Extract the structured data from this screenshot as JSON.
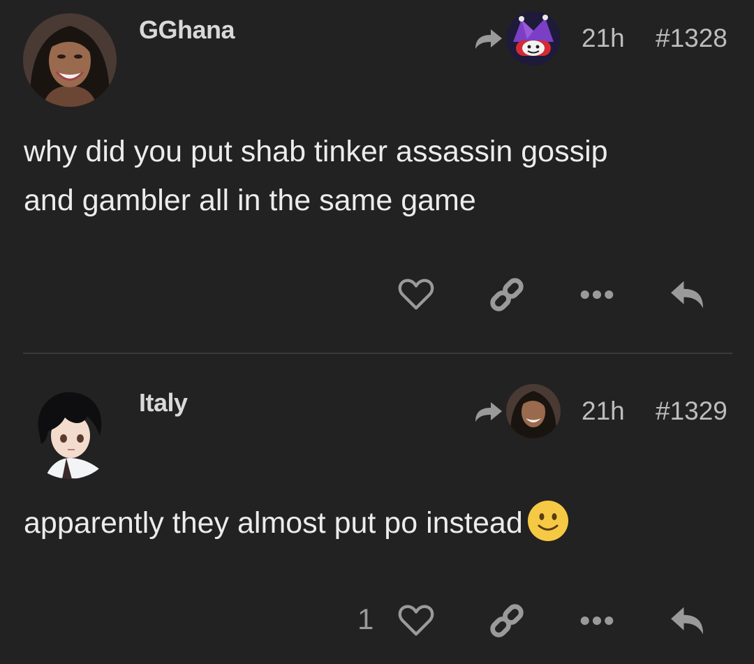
{
  "posts": [
    {
      "username": "GGhana",
      "time": "21h",
      "post_number": "#1328",
      "body_lines": [
        "why did you put shab tinker assassin gossip",
        "and gambler all in the same game"
      ],
      "like_count": "",
      "reply_to_avatar": "jester-avatar"
    },
    {
      "username": "Italy",
      "time": "21h",
      "post_number": "#1329",
      "body_lines": [
        "apparently they almost put po instead"
      ],
      "like_count": "1",
      "reply_to_avatar": "gghana-avatar",
      "emoji": "slightly-smiling-face"
    }
  ],
  "icons": {
    "like": "heart-icon",
    "link": "link-icon",
    "more": "more-dots-icon",
    "reply": "reply-icon",
    "reply_to": "reply-to-arrow-icon"
  },
  "colors": {
    "background": "#222222",
    "divider": "#3a3a3a",
    "text": "#ececec",
    "icon": "#9a9a9a",
    "emoji": "#f6c944"
  }
}
